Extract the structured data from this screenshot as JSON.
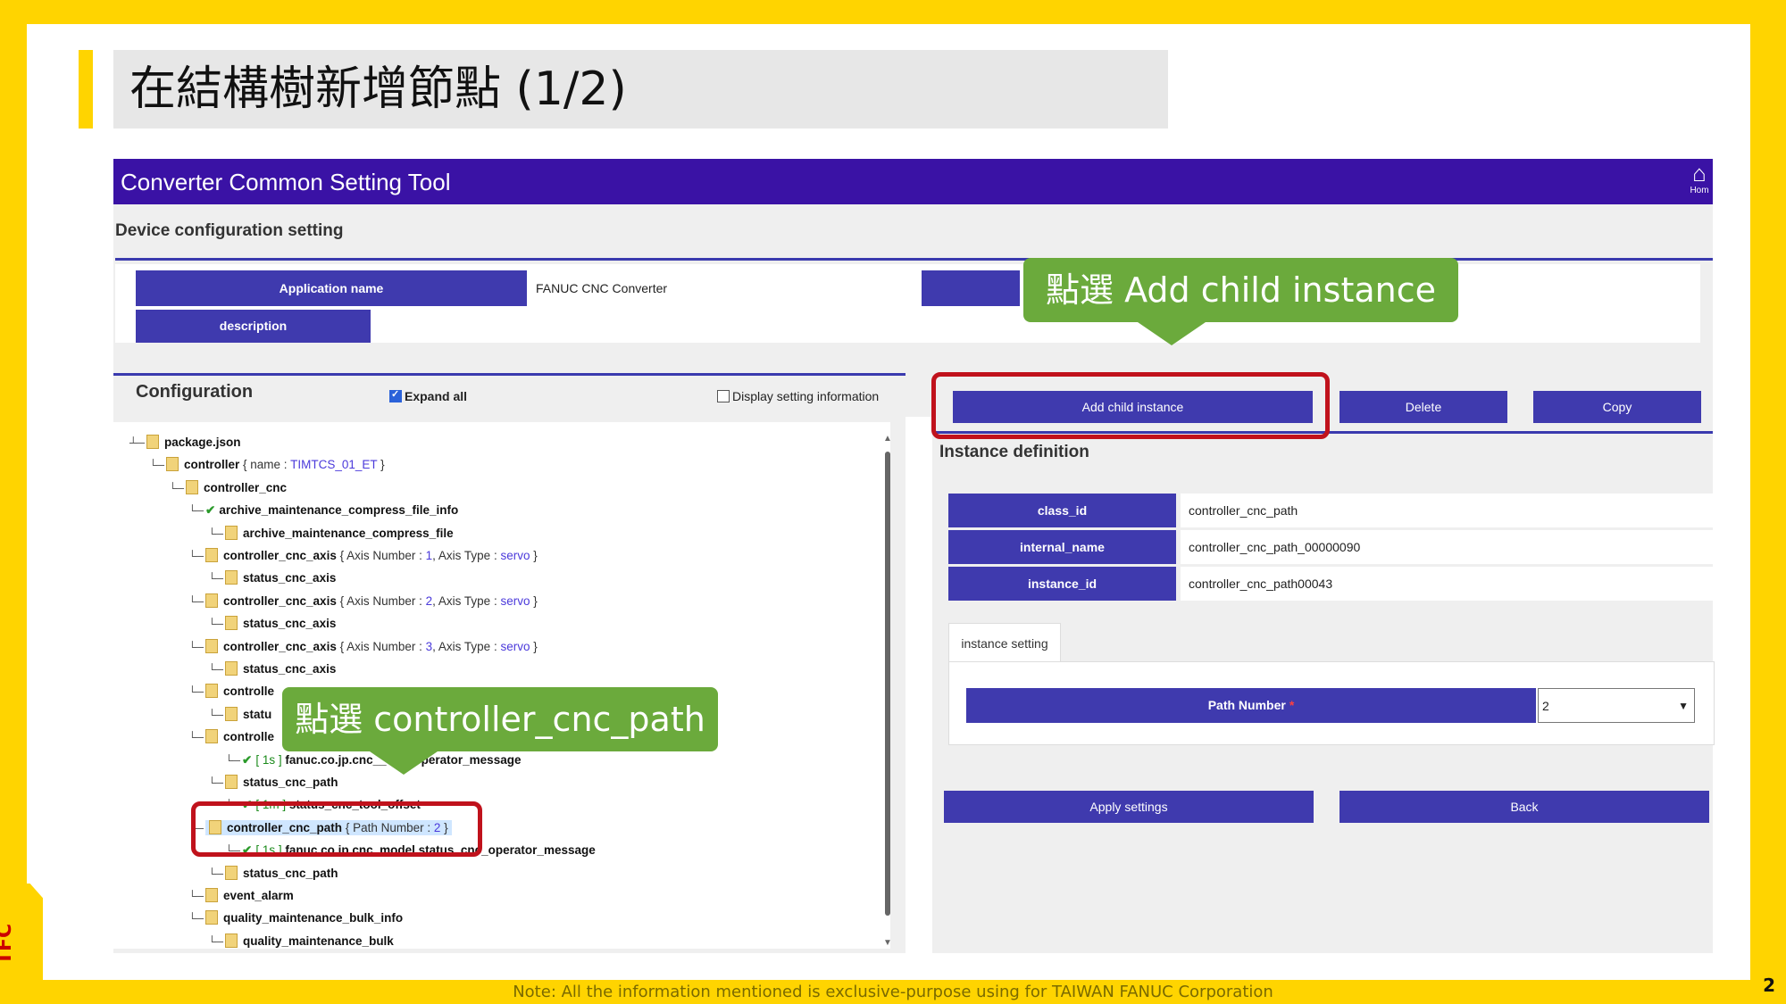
{
  "slide": {
    "title": "在結構樹新增節點 (1/2)",
    "footer_note": "Note: All the information mentioned is exclusive-purpose using for TAIWAN FANUC Corporation",
    "page_number": "2",
    "logo_text": "TFC"
  },
  "app": {
    "title": "Converter Common Setting Tool",
    "home_label": "Hom",
    "section_title": "Device configuration setting",
    "info": {
      "app_name_label": "Application name",
      "app_name_value": "FANUC CNC Converter",
      "description_label": "description"
    },
    "configuration": {
      "title": "Configuration",
      "expand_all": "Expand all",
      "display_setting": "Display setting information"
    },
    "tree": [
      {
        "name": "package.json"
      },
      {
        "name": "controller",
        "attr": "{ name : ",
        "val": "TIMTCS_01_ET",
        "tail": " }"
      },
      {
        "name": "controller_cnc"
      },
      {
        "name": "archive_maintenance_compress_file_info"
      },
      {
        "name": "archive_maintenance_compress_file"
      },
      {
        "name": "controller_cnc_axis",
        "attr": "{ Axis Number : ",
        "num": "1",
        "mid": ", Axis Type : ",
        "val": "servo",
        "tail": " }"
      },
      {
        "name": "status_cnc_axis"
      },
      {
        "name": "controller_cnc_axis",
        "attr": "{ Axis Number : ",
        "num": "2",
        "mid": ", Axis Type : ",
        "val": "servo",
        "tail": " }"
      },
      {
        "name": "status_cnc_axis"
      },
      {
        "name": "controller_cnc_axis",
        "attr": "{ Axis Number : ",
        "num": "3",
        "mid": ", Axis Type : ",
        "val": "servo",
        "tail": " }"
      },
      {
        "name": "status_cnc_axis"
      },
      {
        "name": "controlle"
      },
      {
        "name": "statu"
      },
      {
        "name": "controlle"
      },
      {
        "prefix": "[ 1s ]",
        "name": "fanuc.co.jp.cnc_",
        "tail": "_cnc_operator_message"
      },
      {
        "name": "status_cnc_path"
      },
      {
        "prefix": "[ 1m ]",
        "name": "status_cnc_tool_offset"
      },
      {
        "name": "controller_cnc_path",
        "attr": "{ Path Number : ",
        "num": "2",
        "tail": " }"
      },
      {
        "prefix": "[ 1s ]",
        "name": "fanuc.co.jp.cnc_model.status_cnc_",
        "tail": "operator_message"
      },
      {
        "name": "status_cnc_path"
      },
      {
        "name": "event_alarm"
      },
      {
        "name": "quality_maintenance_bulk_info"
      },
      {
        "name": "quality_maintenance_bulk"
      }
    ],
    "buttons": {
      "add_child": "Add child instance",
      "delete": "Delete",
      "copy": "Copy",
      "apply": "Apply settings",
      "back": "Back"
    },
    "instance": {
      "title": "Instance definition",
      "class_id_label": "class_id",
      "class_id_value": "controller_cnc_path",
      "internal_name_label": "internal_name",
      "internal_name_value": "controller_cnc_path_00000090",
      "instance_id_label": "instance_id",
      "instance_id_value": "controller_cnc_path00043",
      "tab_label": "instance setting",
      "path_number_label": "Path Number",
      "required_mark": "*",
      "path_number_value": "2"
    }
  },
  "callouts": {
    "add_child": "點選 Add child instance",
    "select_path": "點選 controller_cnc_path"
  },
  "colors": {
    "accent_yellow": "#FFD400",
    "header_purple": "#3A12A5",
    "button_blue": "#3F3AAE",
    "callout_green": "#6BAA3C",
    "highlight_red": "#C0121C"
  }
}
